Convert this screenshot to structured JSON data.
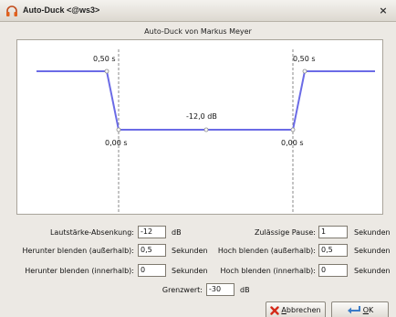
{
  "window": {
    "title": "Auto-Duck <@ws3>",
    "app_icon": "headphones-icon",
    "close_glyph": "×"
  },
  "header": "Auto-Duck von Markus Meyer",
  "plot": {
    "label_fade_down_outer": "0,50 s",
    "label_fade_up_outer": "0,50 s",
    "label_fade_down_inner": "0,00 s",
    "label_fade_up_inner": "0,00 s",
    "label_level": "-12,0 dB",
    "line_color": "#6b6be6"
  },
  "params": {
    "duck_amount": {
      "label": "Lautstärke-Absenkung:",
      "value": "-12",
      "unit": "dB"
    },
    "max_pause": {
      "label": "Zulässige Pause:",
      "value": "1",
      "unit": "Sekunden"
    },
    "outer_fade_down": {
      "label": "Herunter blenden (außerhalb):",
      "value": "0,5",
      "unit": "Sekunden"
    },
    "outer_fade_up": {
      "label": "Hoch blenden (außerhalb):",
      "value": "0,5",
      "unit": "Sekunden"
    },
    "inner_fade_down": {
      "label": "Herunter blenden (innerhalb):",
      "value": "0",
      "unit": "Sekunden"
    },
    "inner_fade_up": {
      "label": "Hoch blenden (innerhalb):",
      "value": "0",
      "unit": "Sekunden"
    },
    "threshold": {
      "label": "Grenzwert:",
      "value": "-30",
      "unit": "dB"
    }
  },
  "buttons": {
    "cancel": {
      "label_prefix": "",
      "mnemonic": "A",
      "label_rest": "bbrechen",
      "icon": "cancel-icon"
    },
    "ok": {
      "mnemonic": "O",
      "label_rest": "K",
      "icon": "ok-icon"
    }
  }
}
